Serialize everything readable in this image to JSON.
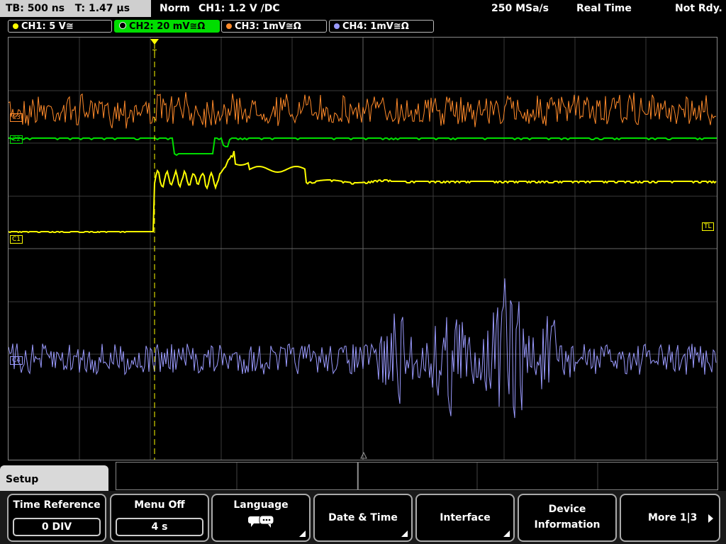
{
  "top": {
    "timebase": "TB: 500 ns",
    "trigger_time": "T: 1.47 µs",
    "mode": "Norm",
    "trigger": "CH1: 1.2 V ∕DC",
    "sample_rate": "250 MSa/s",
    "acq_mode": "Real Time",
    "state": "Not Rdy."
  },
  "channels": [
    {
      "label": "CH1: 5 V≅",
      "color": "#ffff00"
    },
    {
      "label": "CH2: 20 mV≅Ω",
      "color": "#00dd00"
    },
    {
      "label": "CH3: 1mV≅Ω",
      "color": "#ff8a2a"
    },
    {
      "label": "CH4: 1mV≅Ω",
      "color": "#9b9bff"
    }
  ],
  "markers": {
    "c1": "C1",
    "c2": "C2",
    "c3": "C3",
    "c4": "C4",
    "tl": "TL",
    "trigger_top": "T"
  },
  "setup_label": "Setup",
  "menu": {
    "time_ref_label": "Time Reference",
    "time_ref_value": "0 DIV",
    "menu_off_label": "Menu Off",
    "menu_off_value": "4 s",
    "language_label": "Language",
    "language_icon": "speech-bubbles-icon",
    "date_time_label": "Date & Time",
    "interface_label": "Interface",
    "device_info_line1": "Device",
    "device_info_line2": "Information",
    "more_label": "More 1|3"
  }
}
